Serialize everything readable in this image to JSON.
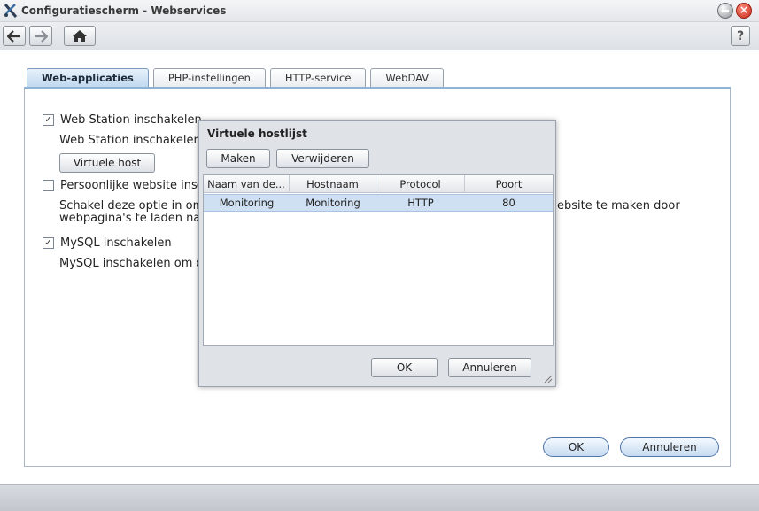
{
  "window": {
    "title": "Configuratiescherm - Webservices",
    "app_icon": "synology-icon"
  },
  "toolbar": {
    "back_icon": "arrow-left-icon",
    "forward_icon": "arrow-right-icon",
    "home_icon": "home-icon",
    "help_label": "?"
  },
  "tabs": [
    {
      "label": "Web-applicaties",
      "active": true
    },
    {
      "label": "PHP-instellingen",
      "active": false
    },
    {
      "label": "HTTP-service",
      "active": false
    },
    {
      "label": "WebDAV",
      "active": false
    }
  ],
  "settings": {
    "web_station": {
      "checked": true,
      "label": "Web Station inschakelen",
      "description": "Web Station inschakelen"
    },
    "virtual_host_button": "Virtuele host",
    "personal_website": {
      "checked": false,
      "label": "Persoonlijke website insc",
      "description_line1": "Schakel deze optie in om",
      "description_line1_right": "ebsite te maken door",
      "description_line2": "webpagina's te laden naa"
    },
    "mysql": {
      "checked": true,
      "label": "MySQL inschakelen",
      "description": "MySQL inschakelen om de"
    }
  },
  "footer": {
    "ok_label": "OK",
    "cancel_label": "Annuleren"
  },
  "dialog": {
    "title": "Virtuele hostlijst",
    "create_label": "Maken",
    "delete_label": "Verwijderen",
    "columns": [
      "Naam van de...",
      "Hostnaam",
      "Protocol",
      "Poort"
    ],
    "rows": [
      {
        "name": "Monitoring",
        "hostname": "Monitoring",
        "protocol": "HTTP",
        "port": "80"
      }
    ],
    "ok_label": "OK",
    "cancel_label": "Annuleren"
  }
}
